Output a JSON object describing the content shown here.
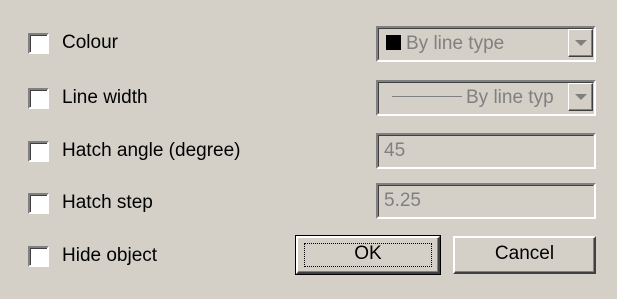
{
  "options": [
    {
      "label": "Colour",
      "checked": false
    },
    {
      "label": "Line width",
      "checked": false
    },
    {
      "label": "Hatch angle (degree)",
      "checked": false
    },
    {
      "label": "Hatch step",
      "checked": false
    },
    {
      "label": "Hide object",
      "checked": false
    }
  ],
  "colour_combo": {
    "value": "By line type",
    "swatch_color": "#000000",
    "enabled": false
  },
  "linewidth_combo": {
    "value": "By line typ",
    "enabled": false
  },
  "hatch_angle_field": {
    "value": "45",
    "enabled": false
  },
  "hatch_step_field": {
    "value": "5.25",
    "enabled": false
  },
  "buttons": {
    "ok_label": "OK",
    "cancel_label": "Cancel"
  },
  "colors": {
    "dialog_background": "#d4d0c8",
    "disabled_text": "#808080",
    "checkbox_fill": "#ffffff"
  }
}
